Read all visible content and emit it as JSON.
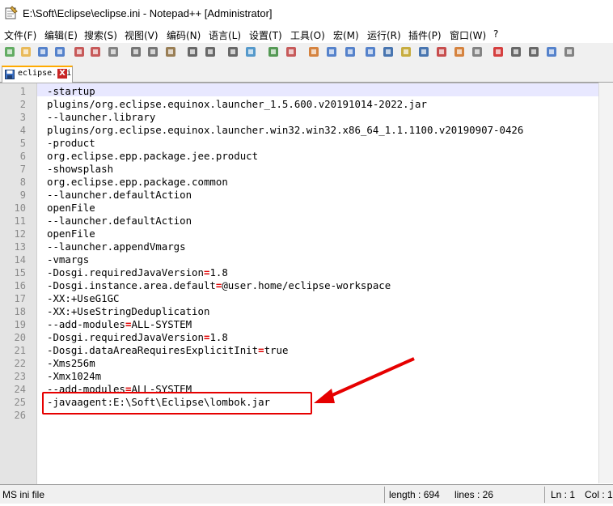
{
  "window": {
    "title": "E:\\Soft\\Eclipse\\eclipse.ini - Notepad++ [Administrator]",
    "icon": "notepad-icon"
  },
  "menu": [
    "文件(F)",
    "编辑(E)",
    "搜索(S)",
    "视图(V)",
    "编码(N)",
    "语言(L)",
    "设置(T)",
    "工具(O)",
    "宏(M)",
    "运行(R)",
    "插件(P)",
    "窗口(W)",
    "?"
  ],
  "toolbar_icons": [
    "new-icon",
    "open-icon",
    "save-icon",
    "save-all-icon",
    "close-icon",
    "close-all-icon",
    "print-icon",
    "cut-icon",
    "copy-icon",
    "paste-icon",
    "undo-icon",
    "redo-icon",
    "find-icon",
    "replace-icon",
    "zoom-in-icon",
    "zoom-out-icon",
    "sync-v-icon",
    "sync-h-icon",
    "wrap-icon",
    "all-chars-icon",
    "indent-guide-icon",
    "udl-icon",
    "doc-map-icon",
    "function-list-icon",
    "folder-workspace-icon",
    "monitor-icon",
    "record-macro-icon",
    "stop-record-icon",
    "play-macro-icon",
    "run-macro-multiple-icon",
    "save-macro-icon"
  ],
  "tab": {
    "label": "eclipse.ini",
    "close": "X"
  },
  "lines": [
    {
      "n": "1",
      "parts": [
        {
          "t": "-startup",
          "c": "key"
        }
      ]
    },
    {
      "n": "2",
      "parts": [
        {
          "t": "plugins/org.eclipse.equinox.launcher_1.5.600.v20191014-2022.jar",
          "c": "key"
        }
      ]
    },
    {
      "n": "3",
      "parts": [
        {
          "t": "--launcher.library",
          "c": "key"
        }
      ]
    },
    {
      "n": "4",
      "parts": [
        {
          "t": "plugins/org.eclipse.equinox.launcher.win32.win32.x86_64_1.1.1100.v20190907-0426",
          "c": "key"
        }
      ]
    },
    {
      "n": "5",
      "parts": [
        {
          "t": "-product",
          "c": "key"
        }
      ]
    },
    {
      "n": "6",
      "parts": [
        {
          "t": "org.eclipse.epp.package.jee.product",
          "c": "key"
        }
      ]
    },
    {
      "n": "7",
      "parts": [
        {
          "t": "-showsplash",
          "c": "key"
        }
      ]
    },
    {
      "n": "8",
      "parts": [
        {
          "t": "org.eclipse.epp.package.common",
          "c": "key"
        }
      ]
    },
    {
      "n": "9",
      "parts": [
        {
          "t": "--launcher.defaultAction",
          "c": "key"
        }
      ]
    },
    {
      "n": "10",
      "parts": [
        {
          "t": "openFile",
          "c": "key"
        }
      ]
    },
    {
      "n": "11",
      "parts": [
        {
          "t": "--launcher.defaultAction",
          "c": "key"
        }
      ]
    },
    {
      "n": "12",
      "parts": [
        {
          "t": "openFile",
          "c": "key"
        }
      ]
    },
    {
      "n": "13",
      "parts": [
        {
          "t": "--launcher.appendVmargs",
          "c": "key"
        }
      ]
    },
    {
      "n": "14",
      "parts": [
        {
          "t": "-vmargs",
          "c": "key"
        }
      ]
    },
    {
      "n": "15",
      "parts": [
        {
          "t": "-Dosgi.requiredJavaVersion",
          "c": "key"
        },
        {
          "t": "=",
          "c": "eq"
        },
        {
          "t": "1.8",
          "c": "val"
        }
      ]
    },
    {
      "n": "16",
      "parts": [
        {
          "t": "-Dosgi.instance.area.default",
          "c": "key"
        },
        {
          "t": "=",
          "c": "eq"
        },
        {
          "t": "@user.home/eclipse-workspace",
          "c": "val"
        }
      ]
    },
    {
      "n": "17",
      "parts": [
        {
          "t": "-XX:+UseG1GC",
          "c": "key"
        }
      ]
    },
    {
      "n": "18",
      "parts": [
        {
          "t": "-XX:+UseStringDeduplication",
          "c": "key"
        }
      ]
    },
    {
      "n": "19",
      "parts": [
        {
          "t": "--add-modules",
          "c": "key"
        },
        {
          "t": "=",
          "c": "eq"
        },
        {
          "t": "ALL-SYSTEM",
          "c": "val"
        }
      ]
    },
    {
      "n": "20",
      "parts": [
        {
          "t": "-Dosgi.requiredJavaVersion",
          "c": "key"
        },
        {
          "t": "=",
          "c": "eq"
        },
        {
          "t": "1.8",
          "c": "val"
        }
      ]
    },
    {
      "n": "21",
      "parts": [
        {
          "t": "-Dosgi.dataAreaRequiresExplicitInit",
          "c": "key"
        },
        {
          "t": "=",
          "c": "eq"
        },
        {
          "t": "true",
          "c": "val"
        }
      ]
    },
    {
      "n": "22",
      "parts": [
        {
          "t": "-Xms256m",
          "c": "key"
        }
      ]
    },
    {
      "n": "23",
      "parts": [
        {
          "t": "-Xmx1024m",
          "c": "key"
        }
      ]
    },
    {
      "n": "24",
      "parts": [
        {
          "t": "--add-modules",
          "c": "key"
        },
        {
          "t": "=",
          "c": "eq"
        },
        {
          "t": "ALL-SYSTEM",
          "c": "val"
        }
      ]
    },
    {
      "n": "25",
      "parts": [
        {
          "t": "-javaagent:E:\\Soft\\Eclipse\\lombok.jar",
          "c": "key"
        }
      ]
    },
    {
      "n": "26",
      "parts": []
    }
  ],
  "status": {
    "filetype": "MS ini file",
    "length": "length : 694",
    "lines": "lines : 26",
    "ln": "Ln : 1",
    "col": "Col : 1"
  },
  "colors": {
    "equals": "#e00000",
    "annotation": "#e60000",
    "current_line": "#e8e8ff"
  }
}
